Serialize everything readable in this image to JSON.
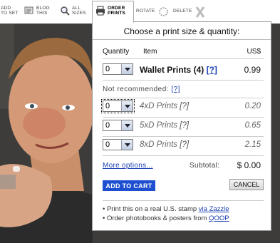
{
  "toolbar": {
    "add_to_set": "ADD\nTO SET",
    "blog_this": "BLOG\nTHIS",
    "all_sizes": "ALL\nSIZES",
    "order_prints": "ORDER\nPRINTS",
    "rotate": "ROTATE",
    "delete": "DELETE"
  },
  "panel": {
    "title": "Choose a print size & quantity:",
    "headers": {
      "quantity": "Quantity",
      "item": "Item",
      "price": "US$"
    },
    "main_item": {
      "qty": "0",
      "name": "Wallet Prints (4)",
      "help": "[?]",
      "price": "0.99"
    },
    "not_recommended": {
      "label": "Not recommended:",
      "help": "[?]"
    },
    "items": [
      {
        "qty": "0",
        "name": "4xD Prints",
        "help": "[?]",
        "price": "0.20"
      },
      {
        "qty": "0",
        "name": "5xD Prints",
        "help": "[?]",
        "price": "0.65"
      },
      {
        "qty": "0",
        "name": "8xD Prints",
        "help": "[?]",
        "price": "2.15"
      }
    ],
    "more_options": "More options...",
    "subtotal_label": "Subtotal:",
    "subtotal_value": "$ 0.00",
    "add_to_cart": "ADD TO CART",
    "cancel": "CANCEL",
    "footer": {
      "line1_prefix": "• Print this on a real U.S. stamp",
      "line1_link": "via Zazzle",
      "line2_prefix": "• Order photobooks & posters from",
      "line2_link": "QOOP"
    }
  },
  "colors": {
    "link": "#1a3fb3",
    "cart_button": "#1e4fd0"
  }
}
